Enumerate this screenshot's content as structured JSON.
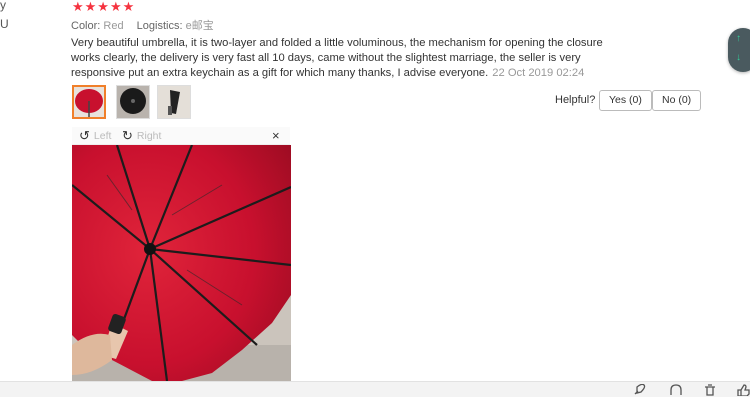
{
  "left_fragments": {
    "top": "y",
    "second": "U"
  },
  "review": {
    "stars": "★★★★★",
    "color_label": "Color:",
    "color_value": "Red",
    "logistics_label": "Logistics:",
    "logistics_value": "e邮宝",
    "text": "Very beautiful umbrella, it is two-layer and folded a little voluminous, the mechanism for opening the closure works clearly, the delivery is very fast all 10 days, came without the slightest marriage, the seller is very responsive put an extra keychain as a gift for which many thanks, I advise everyone.",
    "date": "22 Oct 2019 02:24"
  },
  "helpful": {
    "label": "Helpful?",
    "yes": "Yes (0)",
    "no": "No (0)"
  },
  "viewer": {
    "rotate_left": "Left",
    "rotate_right": "Right",
    "close": "×"
  },
  "icons": {
    "rotate_left": "rotate-left-icon",
    "rotate_right": "rotate-right-icon",
    "close": "close-icon",
    "footer": [
      "rocket-icon",
      "ghost-icon",
      "trash-icon",
      "thumb-icon"
    ]
  },
  "colors": {
    "star": "#f5333f",
    "active_thumb_border": "#f07f2a",
    "umbrella": "#c8102e"
  }
}
